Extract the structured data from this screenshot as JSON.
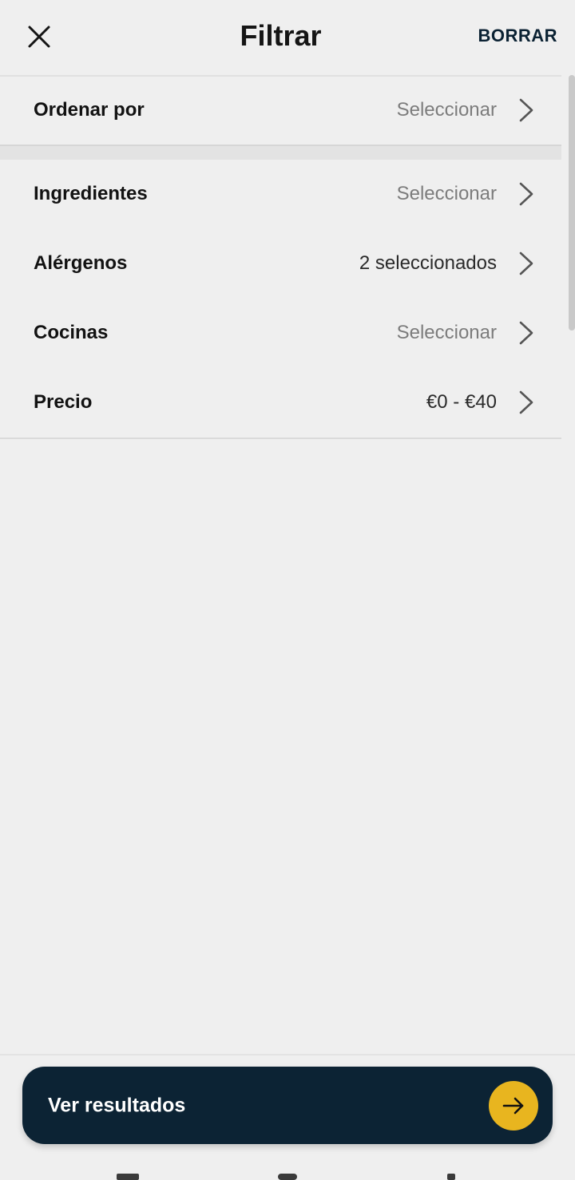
{
  "header": {
    "title": "Filtrar",
    "clear_label": "BORRAR",
    "close_icon": "close-icon"
  },
  "sort": {
    "label": "Ordenar por",
    "value": "Seleccionar"
  },
  "filters": [
    {
      "label": "Ingredientes",
      "value": "Seleccionar",
      "selected": false
    },
    {
      "label": "Alérgenos",
      "value": "2 seleccionados",
      "selected": true
    },
    {
      "label": "Cocinas",
      "value": "Seleccionar",
      "selected": false
    },
    {
      "label": "Precio",
      "value": "€0 - €40",
      "selected": true
    }
  ],
  "footer": {
    "results_label": "Ver resultados",
    "arrow_icon": "arrow-right-icon"
  },
  "colors": {
    "background": "#efefef",
    "button_bg": "#0c2334",
    "accent": "#e8b51f",
    "placeholder_text": "#7c7c7c"
  }
}
